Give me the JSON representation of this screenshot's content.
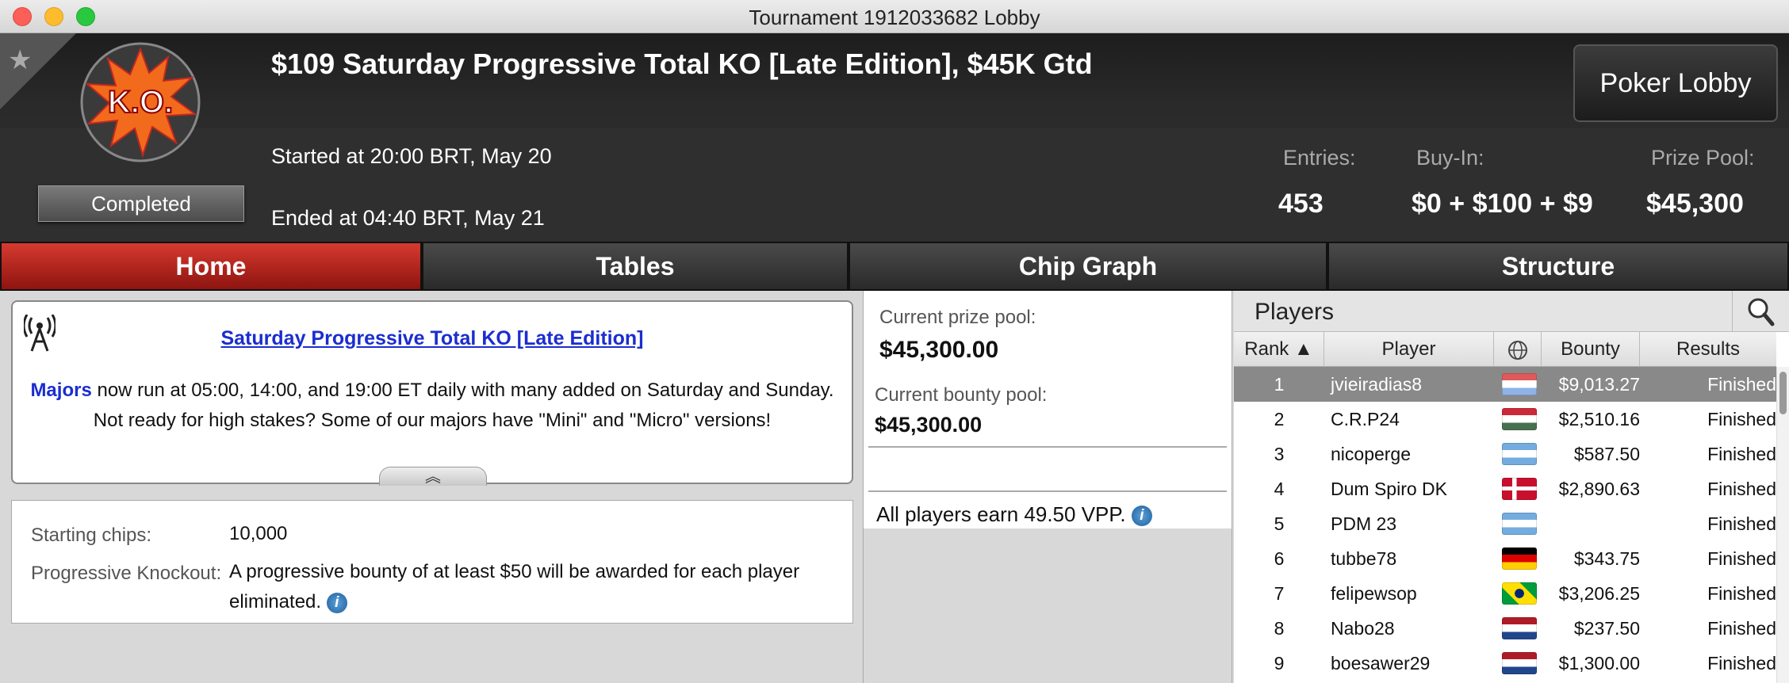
{
  "window": {
    "title": "Tournament 1912033682 Lobby"
  },
  "header": {
    "tournament_name": "$109 Saturday Progressive Total KO [Late Edition], $45K Gtd",
    "logo_text": "K.O.",
    "status": "Completed",
    "started": "Started at 20:00 BRT, May 20",
    "ended": "Ended at 04:40 BRT, May 21",
    "poker_lobby_label": "Poker Lobby",
    "entries_label": "Entries:",
    "entries_value": "453",
    "buyin_label": "Buy-In:",
    "buyin_value": "$0 + $100 + $9",
    "prizepool_label": "Prize Pool:",
    "prizepool_value": "$45,300"
  },
  "tabs": [
    {
      "label": "Home",
      "active": true
    },
    {
      "label": "Tables",
      "active": false
    },
    {
      "label": "Chip Graph",
      "active": false
    },
    {
      "label": "Structure",
      "active": false
    }
  ],
  "news": {
    "title": "Saturday Progressive Total KO [Late Edition]",
    "majors": "Majors",
    "line1_rest": " now run at 05:00, 14:00, and 19:00 ET daily with many added on Saturday and Sunday.",
    "line2": "Not ready for high stakes? Some of our majors have \"Mini\" and \"Micro\" versions!",
    "collapse_glyph": "︽"
  },
  "info": {
    "starting_chips_label": "Starting chips:",
    "starting_chips_value": "10,000",
    "pko_label": "Progressive Knockout:",
    "pko_line1": "A progressive bounty of at least $50 will be awarded for each player",
    "pko_line2": "eliminated."
  },
  "pools": {
    "prize_label": "Current prize pool:",
    "prize_value": "$45,300.00",
    "bounty_label": "Current bounty pool:",
    "bounty_value": "$45,300.00",
    "vpp_text": "All players earn 49.50 VPP."
  },
  "players": {
    "title": "Players",
    "columns": {
      "rank": "Rank ▲",
      "player": "Player",
      "bounty": "Bounty",
      "results": "Results"
    },
    "rows": [
      {
        "rank": "1",
        "name": "jvieiradias8",
        "flag": "netherlands-light",
        "bounty": "$9,013.27",
        "result": "Finished"
      },
      {
        "rank": "2",
        "name": "C.R.P24",
        "flag": "hungary",
        "bounty": "$2,510.16",
        "result": "Finished"
      },
      {
        "rank": "3",
        "name": "nicoperge",
        "flag": "argentina",
        "bounty": "$587.50",
        "result": "Finished"
      },
      {
        "rank": "4",
        "name": "Dum Spiro DK",
        "flag": "denmark",
        "bounty": "$2,890.63",
        "result": "Finished"
      },
      {
        "rank": "5",
        "name": "PDM 23",
        "flag": "argentina",
        "bounty": "",
        "result": "Finished"
      },
      {
        "rank": "6",
        "name": "tubbe78",
        "flag": "germany",
        "bounty": "$343.75",
        "result": "Finished"
      },
      {
        "rank": "7",
        "name": "felipewsop",
        "flag": "brazil",
        "bounty": "$3,206.25",
        "result": "Finished"
      },
      {
        "rank": "8",
        "name": "Nabo28",
        "flag": "netherlands",
        "bounty": "$237.50",
        "result": "Finished"
      },
      {
        "rank": "9",
        "name": "boesawer29",
        "flag": "netherlands",
        "bounty": "$1,300.00",
        "result": "Finished"
      }
    ]
  },
  "colors": {
    "active_tab": "#c0281f",
    "link_blue": "#1b2dcf",
    "selected_row": "#898989"
  }
}
